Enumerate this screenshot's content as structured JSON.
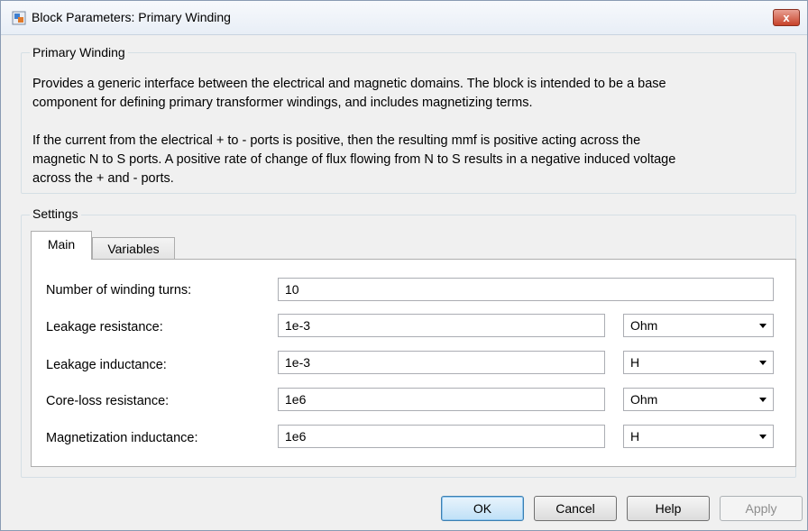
{
  "window": {
    "title": "Block Parameters: Primary Winding",
    "close_glyph": "x",
    "icon": "simulink-block-icon"
  },
  "description_group": {
    "label": "Primary Winding",
    "paragraph1_line1": "Provides a generic interface between the electrical and magnetic domains. The block is intended to be a base",
    "paragraph1_line2": "component for defining primary transformer windings, and includes magnetizing terms.",
    "paragraph2_line1": "If the current from the electrical + to - ports is positive, then the resulting mmf is positive acting across the",
    "paragraph2_line2": "magnetic N to S ports. A positive rate of change of flux flowing from N to S results in a negative induced voltage",
    "paragraph2_line3": "across the + and - ports."
  },
  "settings_group": {
    "label": "Settings",
    "tabs": [
      {
        "label": "Main",
        "active": true
      },
      {
        "label": "Variables",
        "active": false
      }
    ],
    "params": [
      {
        "label": "Number of winding turns:",
        "value": "10",
        "unit": ""
      },
      {
        "label": "Leakage resistance:",
        "value": "1e-3",
        "unit": "Ohm"
      },
      {
        "label": "Leakage inductance:",
        "value": "1e-3",
        "unit": "H"
      },
      {
        "label": "Core-loss resistance:",
        "value": "1e6",
        "unit": "Ohm"
      },
      {
        "label": "Magnetization inductance:",
        "value": "1e6",
        "unit": "H"
      }
    ]
  },
  "buttons": {
    "ok": "OK",
    "cancel": "Cancel",
    "help": "Help",
    "apply": "Apply"
  },
  "colors": {
    "close_button": "#c7432a",
    "default_button_border": "#3c7fb1"
  }
}
